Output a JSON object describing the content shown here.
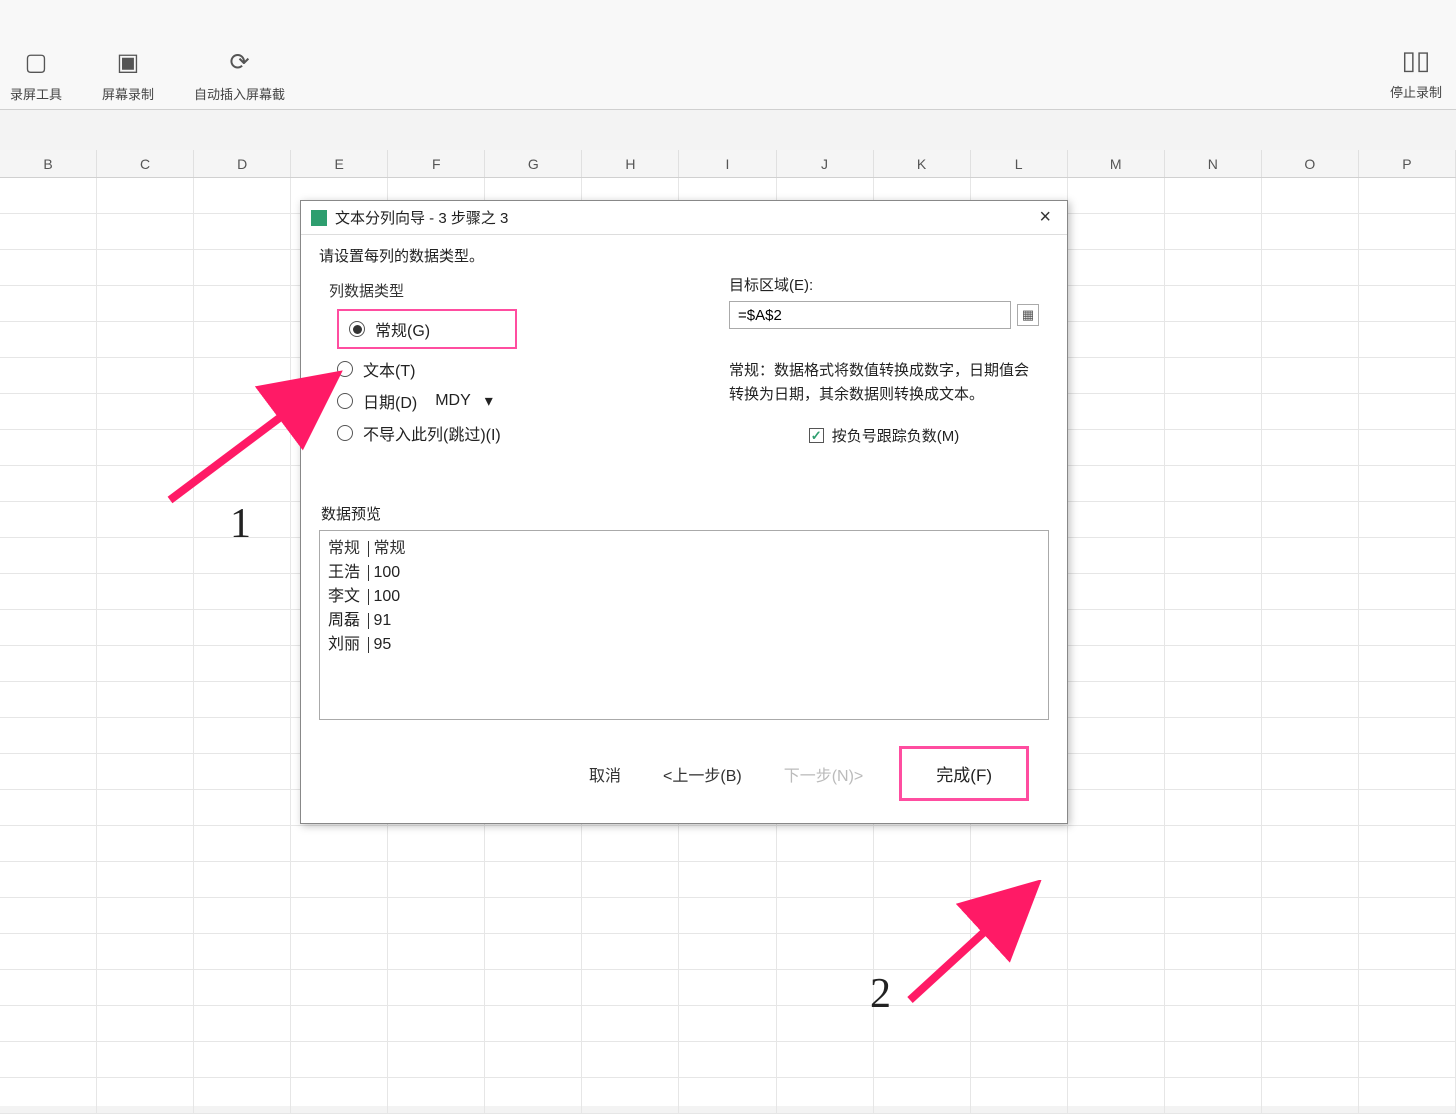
{
  "ribbon": {
    "item1": "录屏工具",
    "item2": "屏幕录制",
    "item3": "自动插入屏幕截",
    "right": "停止录制"
  },
  "columns": [
    "B",
    "C",
    "D",
    "E",
    "F",
    "G",
    "H",
    "I",
    "J",
    "K",
    "L",
    "M",
    "N",
    "O",
    "P"
  ],
  "dialog": {
    "title": "文本分列向导 - 3 步骤之 3",
    "hint": "请设置每列的数据类型。",
    "group_label": "列数据类型",
    "opt_general": "常规(G)",
    "opt_text": "文本(T)",
    "opt_date": "日期(D)",
    "date_fmt": "MDY",
    "opt_skip": "不导入此列(跳过)(I)",
    "target_label": "目标区域(E):",
    "target_value": "=$A$2",
    "desc": "常规：数据格式将数值转换成数字，日期值会转换为日期，其余数据则转换成文本。",
    "chk_label": "按负号跟踪负数(M)",
    "preview_label": "数据预览",
    "preview": {
      "header": [
        "常规",
        "常规"
      ],
      "rows": [
        [
          "王浩",
          "100"
        ],
        [
          "李文",
          "100"
        ],
        [
          "周磊",
          "91"
        ],
        [
          "刘丽",
          "95"
        ]
      ]
    },
    "btn_cancel": "取消",
    "btn_back": "<上一步(B)",
    "btn_next": "下一步(N)>",
    "btn_finish": "完成(F)"
  },
  "annotations": {
    "label1": "1",
    "label2": "2"
  }
}
